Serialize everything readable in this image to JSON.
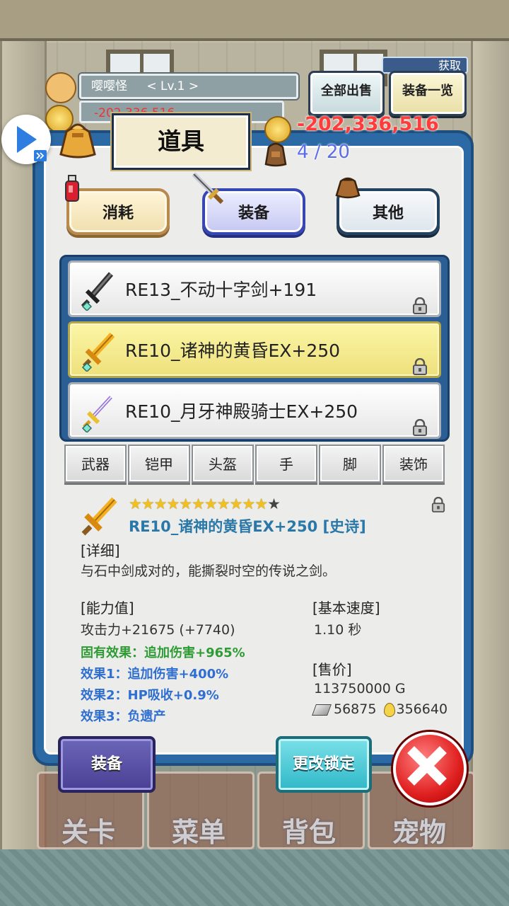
{
  "hud": {
    "player_name": "嘤嘤怪",
    "player_level": "< Lv.1 >",
    "hud_gold_partial": "-202,336,516",
    "sell_all": "全部出售",
    "equip_list": "装备一览",
    "capture": "获取"
  },
  "panel": {
    "title": "道具",
    "gold": "-202,336,516",
    "capacity": "4 / 20"
  },
  "categories": [
    "消耗",
    "装备",
    "其他"
  ],
  "items": [
    {
      "name": "RE13_不动十字剑+191",
      "selected": false
    },
    {
      "name": "RE10_诸神的黄昏EX+250",
      "selected": true
    },
    {
      "name": "RE10_月牙神殿骑士EX+250",
      "selected": false
    }
  ],
  "slot_tabs": [
    "武器",
    "铠甲",
    "头盔",
    "手",
    "脚",
    "装饰"
  ],
  "detail": {
    "stars": "★★★★★★★★★★★",
    "stars_empty": "★",
    "name": "RE10_诸神的黄昏EX+250 [史诗]",
    "detail_label": "[详细]",
    "description": "与石中剑成对的，能撕裂时空的传说之剑。",
    "stats_label": "[能力值]",
    "attack": "攻击力+21675 (+7740)",
    "inherent": "固有效果：追加伤害+965%",
    "effect1": "效果1：追加伤害+400%",
    "effect2": "效果2：HP吸收+0.9%",
    "effect3": "效果3：负遗产",
    "speed_label": "[基本速度]",
    "speed": "1.10 秒",
    "price_label": "[售价]",
    "price": "113750000 G",
    "price_crystal": "56875",
    "price_drop": "356640"
  },
  "actions": {
    "equip": "装备",
    "change_lock": "更改锁定"
  },
  "nav": [
    "关卡",
    "菜单",
    "背包",
    "宠物"
  ],
  "colors": {
    "panel_blue": "#2c6aa5",
    "selected_row": "#f3e88a",
    "gold_negative": "#ff3b3b",
    "capacity": "#5b6ee8"
  }
}
